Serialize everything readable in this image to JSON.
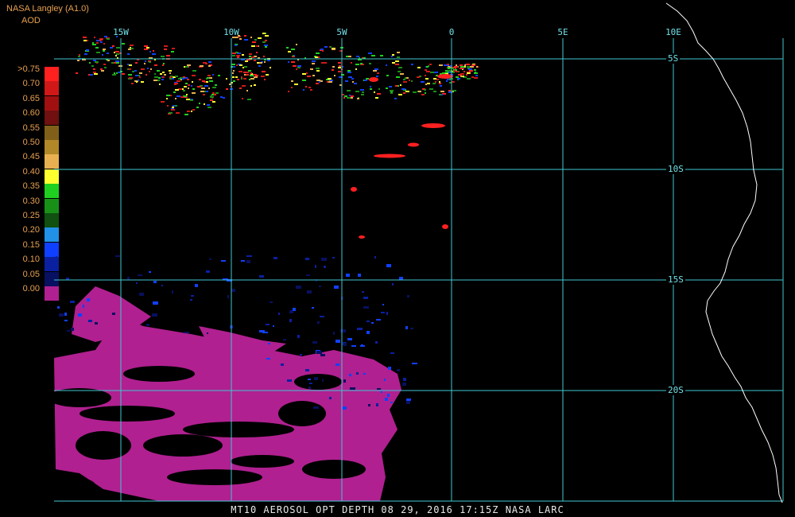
{
  "header": {
    "source": "NASA Langley (A1.0)",
    "product": "AOD"
  },
  "legend": [
    {
      "label": ">0.75",
      "color": "#ff2020"
    },
    {
      "label": "0.70",
      "color": "#d01818"
    },
    {
      "label": "0.65",
      "color": "#a01010"
    },
    {
      "label": "0.60",
      "color": "#701010"
    },
    {
      "label": "0.55",
      "color": "#806018"
    },
    {
      "label": "0.50",
      "color": "#b08828"
    },
    {
      "label": "0.45",
      "color": "#e8b050"
    },
    {
      "label": "0.40",
      "color": "#ffff30"
    },
    {
      "label": "0.35",
      "color": "#20d020"
    },
    {
      "label": "0.30",
      "color": "#189018"
    },
    {
      "label": "0.25",
      "color": "#105010"
    },
    {
      "label": "0.20",
      "color": "#2090e8"
    },
    {
      "label": "0.15",
      "color": "#1040ff"
    },
    {
      "label": "0.10",
      "color": "#0a20a0"
    },
    {
      "label": "0.05",
      "color": "#081060"
    },
    {
      "label": "0.00",
      "color": "#b02090"
    }
  ],
  "grid": {
    "color": "#40c8d0",
    "lon_labels": [
      "15W",
      "10W",
      "5W",
      "0",
      "5E",
      "10E"
    ],
    "lat_labels": [
      "5S",
      "10S",
      "15S",
      "20S"
    ]
  },
  "footer": {
    "caption": "MT10  AEROSOL OPT DEPTH   08 29, 2016 17:15Z   NASA LARC"
  },
  "colors": {
    "background": "#000000",
    "coastline": "#ffffff",
    "low_aod": "#b02090",
    "blue": "#1030c0",
    "green": "#20c020",
    "yellow": "#ffff30",
    "red": "#ff2020"
  }
}
